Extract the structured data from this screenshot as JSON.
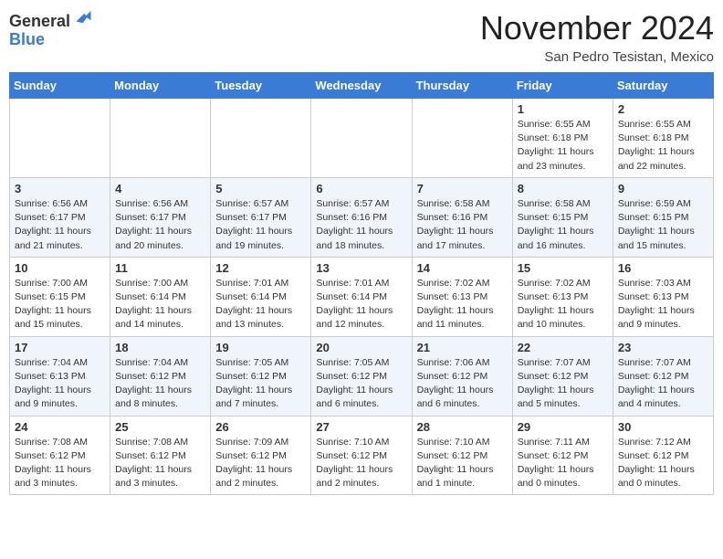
{
  "logo": {
    "general": "General",
    "blue": "Blue"
  },
  "title": "November 2024",
  "location": "San Pedro Tesistan, Mexico",
  "days_header": [
    "Sunday",
    "Monday",
    "Tuesday",
    "Wednesday",
    "Thursday",
    "Friday",
    "Saturday"
  ],
  "weeks": [
    [
      {
        "day": "",
        "info": ""
      },
      {
        "day": "",
        "info": ""
      },
      {
        "day": "",
        "info": ""
      },
      {
        "day": "",
        "info": ""
      },
      {
        "day": "",
        "info": ""
      },
      {
        "day": "1",
        "info": "Sunrise: 6:55 AM\nSunset: 6:18 PM\nDaylight: 11 hours and 23 minutes."
      },
      {
        "day": "2",
        "info": "Sunrise: 6:55 AM\nSunset: 6:18 PM\nDaylight: 11 hours and 22 minutes."
      }
    ],
    [
      {
        "day": "3",
        "info": "Sunrise: 6:56 AM\nSunset: 6:17 PM\nDaylight: 11 hours and 21 minutes."
      },
      {
        "day": "4",
        "info": "Sunrise: 6:56 AM\nSunset: 6:17 PM\nDaylight: 11 hours and 20 minutes."
      },
      {
        "day": "5",
        "info": "Sunrise: 6:57 AM\nSunset: 6:17 PM\nDaylight: 11 hours and 19 minutes."
      },
      {
        "day": "6",
        "info": "Sunrise: 6:57 AM\nSunset: 6:16 PM\nDaylight: 11 hours and 18 minutes."
      },
      {
        "day": "7",
        "info": "Sunrise: 6:58 AM\nSunset: 6:16 PM\nDaylight: 11 hours and 17 minutes."
      },
      {
        "day": "8",
        "info": "Sunrise: 6:58 AM\nSunset: 6:15 PM\nDaylight: 11 hours and 16 minutes."
      },
      {
        "day": "9",
        "info": "Sunrise: 6:59 AM\nSunset: 6:15 PM\nDaylight: 11 hours and 15 minutes."
      }
    ],
    [
      {
        "day": "10",
        "info": "Sunrise: 7:00 AM\nSunset: 6:15 PM\nDaylight: 11 hours and 15 minutes."
      },
      {
        "day": "11",
        "info": "Sunrise: 7:00 AM\nSunset: 6:14 PM\nDaylight: 11 hours and 14 minutes."
      },
      {
        "day": "12",
        "info": "Sunrise: 7:01 AM\nSunset: 6:14 PM\nDaylight: 11 hours and 13 minutes."
      },
      {
        "day": "13",
        "info": "Sunrise: 7:01 AM\nSunset: 6:14 PM\nDaylight: 11 hours and 12 minutes."
      },
      {
        "day": "14",
        "info": "Sunrise: 7:02 AM\nSunset: 6:13 PM\nDaylight: 11 hours and 11 minutes."
      },
      {
        "day": "15",
        "info": "Sunrise: 7:02 AM\nSunset: 6:13 PM\nDaylight: 11 hours and 10 minutes."
      },
      {
        "day": "16",
        "info": "Sunrise: 7:03 AM\nSunset: 6:13 PM\nDaylight: 11 hours and 9 minutes."
      }
    ],
    [
      {
        "day": "17",
        "info": "Sunrise: 7:04 AM\nSunset: 6:13 PM\nDaylight: 11 hours and 9 minutes."
      },
      {
        "day": "18",
        "info": "Sunrise: 7:04 AM\nSunset: 6:12 PM\nDaylight: 11 hours and 8 minutes."
      },
      {
        "day": "19",
        "info": "Sunrise: 7:05 AM\nSunset: 6:12 PM\nDaylight: 11 hours and 7 minutes."
      },
      {
        "day": "20",
        "info": "Sunrise: 7:05 AM\nSunset: 6:12 PM\nDaylight: 11 hours and 6 minutes."
      },
      {
        "day": "21",
        "info": "Sunrise: 7:06 AM\nSunset: 6:12 PM\nDaylight: 11 hours and 6 minutes."
      },
      {
        "day": "22",
        "info": "Sunrise: 7:07 AM\nSunset: 6:12 PM\nDaylight: 11 hours and 5 minutes."
      },
      {
        "day": "23",
        "info": "Sunrise: 7:07 AM\nSunset: 6:12 PM\nDaylight: 11 hours and 4 minutes."
      }
    ],
    [
      {
        "day": "24",
        "info": "Sunrise: 7:08 AM\nSunset: 6:12 PM\nDaylight: 11 hours and 3 minutes."
      },
      {
        "day": "25",
        "info": "Sunrise: 7:08 AM\nSunset: 6:12 PM\nDaylight: 11 hours and 3 minutes."
      },
      {
        "day": "26",
        "info": "Sunrise: 7:09 AM\nSunset: 6:12 PM\nDaylight: 11 hours and 2 minutes."
      },
      {
        "day": "27",
        "info": "Sunrise: 7:10 AM\nSunset: 6:12 PM\nDaylight: 11 hours and 2 minutes."
      },
      {
        "day": "28",
        "info": "Sunrise: 7:10 AM\nSunset: 6:12 PM\nDaylight: 11 hours and 1 minute."
      },
      {
        "day": "29",
        "info": "Sunrise: 7:11 AM\nSunset: 6:12 PM\nDaylight: 11 hours and 0 minutes."
      },
      {
        "day": "30",
        "info": "Sunrise: 7:12 AM\nSunset: 6:12 PM\nDaylight: 11 hours and 0 minutes."
      }
    ]
  ]
}
